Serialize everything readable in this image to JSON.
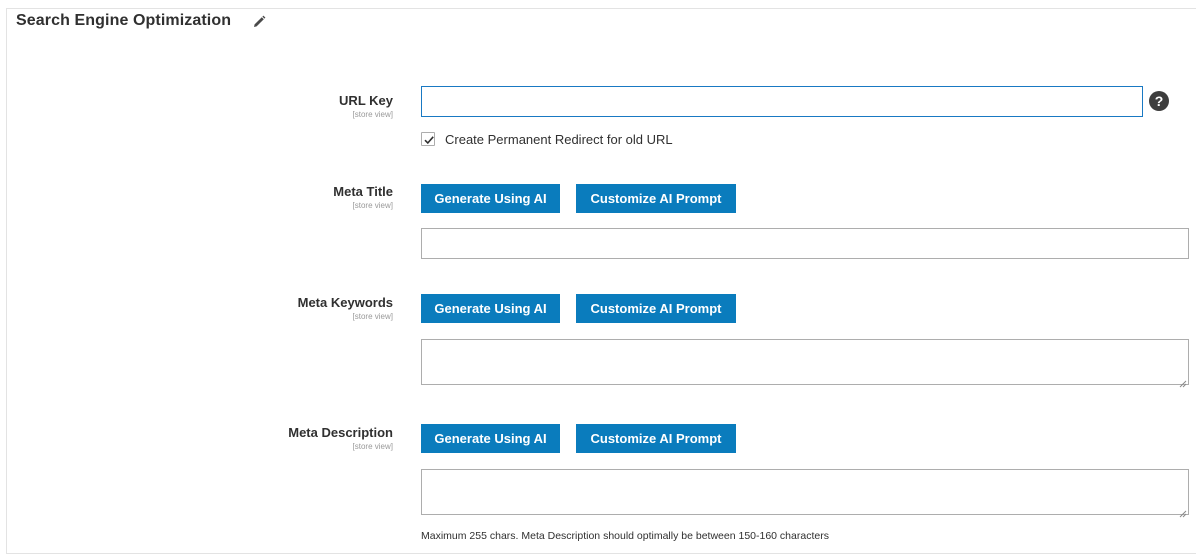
{
  "section": {
    "title": "Search Engine Optimization",
    "edit_icon": "pencil-icon"
  },
  "url_key": {
    "label": "URL Key",
    "scope": "[store view]",
    "value": "",
    "help_icon": "question-icon",
    "help_glyph": "?",
    "redirect_checkbox": {
      "label": "Create Permanent Redirect for old URL",
      "checked": true
    }
  },
  "meta_title": {
    "label": "Meta Title",
    "scope": "[store view]",
    "generate_label": "Generate Using AI",
    "customize_label": "Customize AI Prompt",
    "value": ""
  },
  "meta_keywords": {
    "label": "Meta Keywords",
    "scope": "[store view]",
    "generate_label": "Generate Using AI",
    "customize_label": "Customize AI Prompt",
    "value": ""
  },
  "meta_description": {
    "label": "Meta Description",
    "scope": "[store view]",
    "generate_label": "Generate Using AI",
    "customize_label": "Customize AI Prompt",
    "value": "",
    "note": "Maximum 255 chars. Meta Description should optimally be between 150-160 characters"
  },
  "colors": {
    "button_bg": "#0a7cbd",
    "focus_border": "#1979c3",
    "text": "#303030"
  }
}
